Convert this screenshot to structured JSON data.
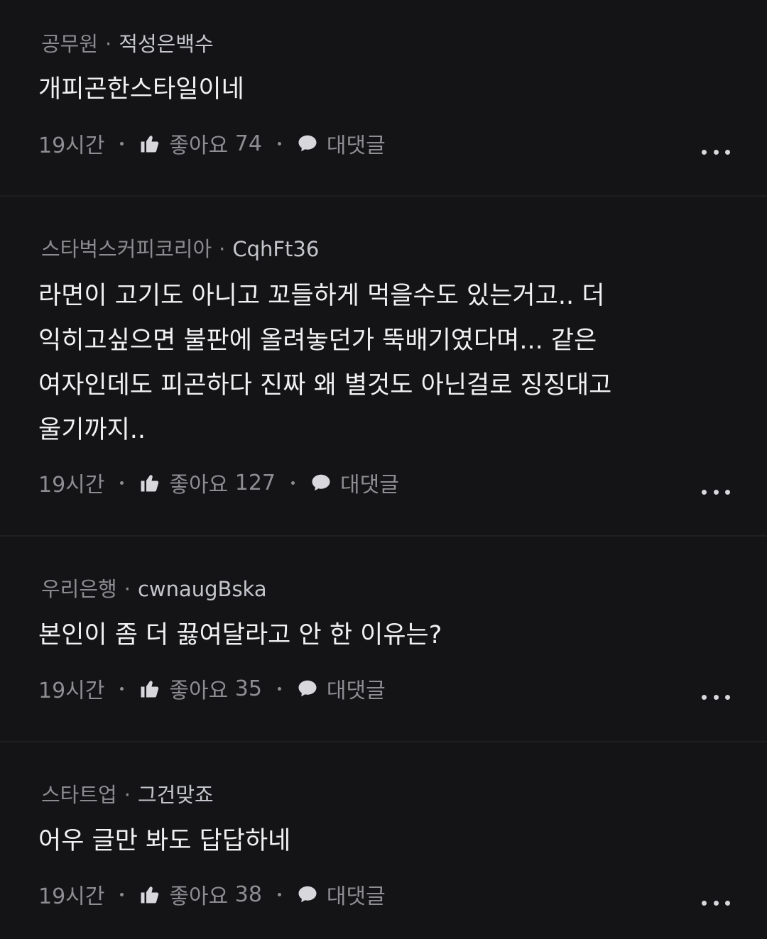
{
  "comments": [
    {
      "company": "공무원",
      "nickname": "적성은백수",
      "text": "개피곤한스타일이네",
      "time": "19시간",
      "like_label": "좋아요",
      "likes": "74",
      "reply_label": "대댓글"
    },
    {
      "company": "스타벅스커피코리아",
      "nickname": "CqhFt36",
      "text": "라면이 고기도 아니고 꼬들하게 먹을수도 있는거고.. 더\n익히고싶으면 불판에 올려놓던가 뚝배기였다며... 같은\n여자인데도 피곤하다 진짜 왜 별것도 아닌걸로 징징대고\n울기까지..",
      "time": "19시간",
      "like_label": "좋아요",
      "likes": "127",
      "reply_label": "대댓글"
    },
    {
      "company": "우리은행",
      "nickname": "cwnaugBska",
      "text": "본인이 좀 더 끓여달라고 안 한 이유는?",
      "time": "19시간",
      "like_label": "좋아요",
      "likes": "35",
      "reply_label": "대댓글"
    },
    {
      "company": "스타트업",
      "nickname": "그건맞죠",
      "text": "어우 글만 봐도 답답하네",
      "time": "19시간",
      "like_label": "좋아요",
      "likes": "38",
      "reply_label": "대댓글"
    }
  ],
  "icons": {
    "like": "thumbs-up-icon",
    "reply": "speech-bubble-icon",
    "more": "more-dots-icon"
  },
  "colors": {
    "background": "#141416",
    "text": "#f1f1f3",
    "meta": "#8e8e92"
  }
}
